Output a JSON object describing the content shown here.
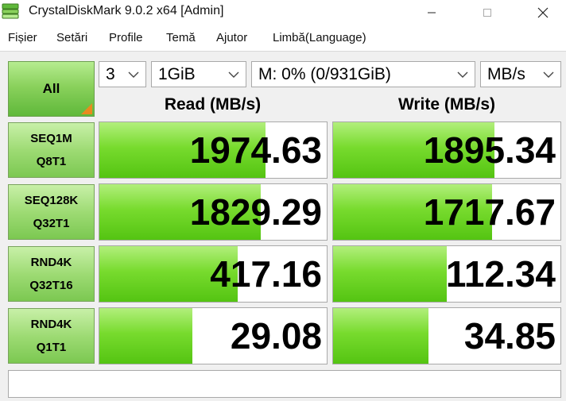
{
  "window": {
    "title": "CrystalDiskMark 9.0.2 x64 [Admin]"
  },
  "menu": [
    "Fișier",
    "Setări",
    "Profile",
    "Temă",
    "Ajutor",
    "Limbă(Language)"
  ],
  "controls": {
    "all_label": "All",
    "count": "3",
    "size": "1GiB",
    "drive": "M: 0% (0/931GiB)",
    "unit": "MB/s"
  },
  "headers": {
    "read": "Read (MB/s)",
    "write": "Write (MB/s)"
  },
  "rows": [
    {
      "line1": "SEQ1M",
      "line2": "Q8T1",
      "read": "1974.63",
      "write": "1895.34",
      "read_fill": 0.73,
      "write_fill": 0.71
    },
    {
      "line1": "SEQ128K",
      "line2": "Q32T1",
      "read": "1829.29",
      "write": "1717.67",
      "read_fill": 0.71,
      "write_fill": 0.7
    },
    {
      "line1": "RND4K",
      "line2": "Q32T16",
      "read": "417.16",
      "write": "112.34",
      "read_fill": 0.61,
      "write_fill": 0.5
    },
    {
      "line1": "RND4K",
      "line2": "Q1T1",
      "read": "29.08",
      "write": "34.85",
      "read_fill": 0.41,
      "write_fill": 0.42
    }
  ],
  "colors": {
    "bar_green": "#54c412",
    "label_green": "#9edb74",
    "corner_orange": "#e98a1e"
  }
}
